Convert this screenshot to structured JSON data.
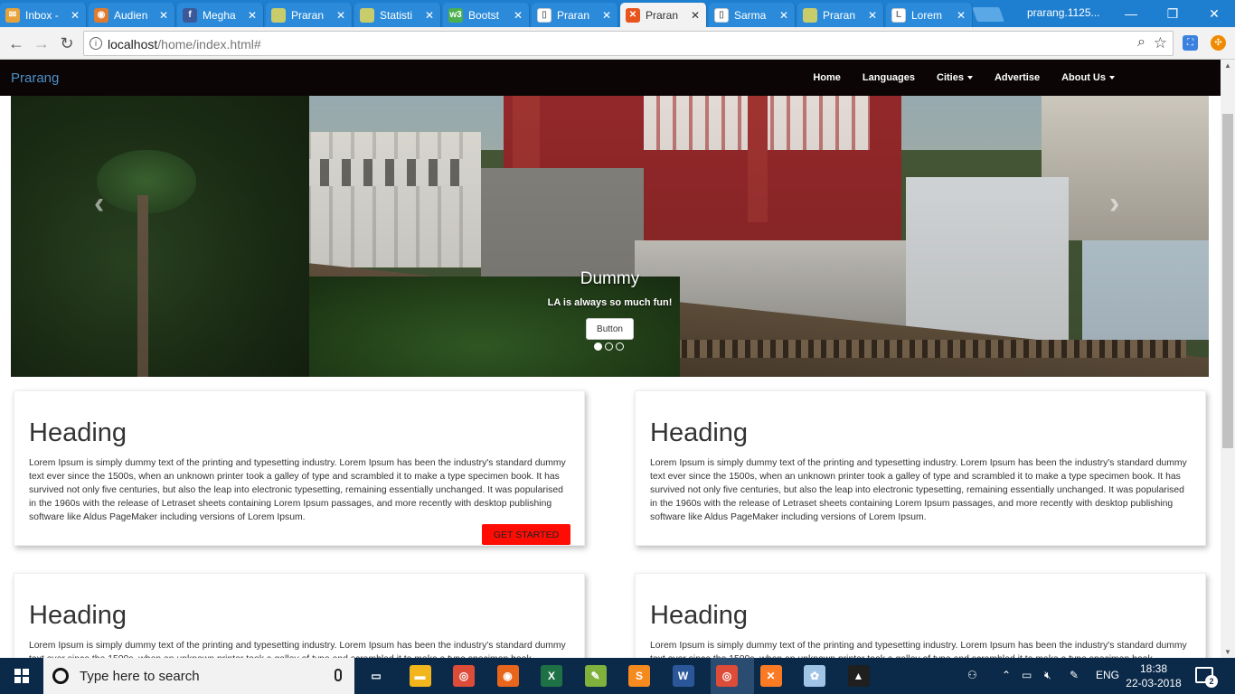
{
  "browser": {
    "tabs": [
      {
        "title": "Inbox - ",
        "color": "#e8a23a",
        "glyph": "✉"
      },
      {
        "title": "Audien",
        "color": "#e07b2f",
        "glyph": "◉"
      },
      {
        "title": "Megha",
        "color": "#3b5998",
        "glyph": "f"
      },
      {
        "title": "Praran",
        "color": "#c9cc6a",
        "glyph": ""
      },
      {
        "title": "Statisti",
        "color": "#c9cc6a",
        "glyph": ""
      },
      {
        "title": "Bootst",
        "color": "#4caf50",
        "glyph": "w3"
      },
      {
        "title": "Praran",
        "color": "#ffffff",
        "glyph": "▯"
      },
      {
        "title": "Praran",
        "color": "#e8541e",
        "glyph": "✕"
      },
      {
        "title": "Sarma",
        "color": "#ffffff",
        "glyph": "▯"
      },
      {
        "title": "Praran",
        "color": "#c9cc6a",
        "glyph": ""
      },
      {
        "title": "Lorem",
        "color": "#ffffff",
        "glyph": "L"
      }
    ],
    "active_tab": 7,
    "profile": "prarang.1125...",
    "window_controls": {
      "minimize": "—",
      "maximize": "❐",
      "close": "✕"
    },
    "url_host": "localhost",
    "url_path": "/home/index.html#",
    "back": "←",
    "forward": "→",
    "reload": "↻",
    "zoom_glyph": "⌕",
    "star_glyph": "☆"
  },
  "site": {
    "brand": "Prarang",
    "menu": [
      {
        "label": "Home",
        "dropdown": false
      },
      {
        "label": "Languages",
        "dropdown": false
      },
      {
        "label": "Cities",
        "dropdown": true
      },
      {
        "label": "Advertise",
        "dropdown": false
      },
      {
        "label": "About Us",
        "dropdown": true
      }
    ],
    "carousel": {
      "title": "Dummy",
      "subtitle": "LA is always so much fun!",
      "button": "Button",
      "prev": "‹",
      "next": "›",
      "slides": 3,
      "active_slide": 0
    },
    "cards": [
      {
        "heading": "Heading",
        "text": "Lorem Ipsum is simply dummy text of the printing and typesetting industry. Lorem Ipsum has been the industry's standard dummy text ever since the 1500s, when an unknown printer took a galley of type and scrambled it to make a type specimen book. It has survived not only five centuries, but also the leap into electronic typesetting, remaining essentially unchanged. It was popularised in the 1960s with the release of Letraset sheets containing Lorem Ipsum passages, and more recently with desktop publishing software like Aldus PageMaker including versions of Lorem Ipsum.",
        "button": "GET STARTED"
      },
      {
        "heading": "Heading",
        "text": "Lorem Ipsum is simply dummy text of the printing and typesetting industry. Lorem Ipsum has been the industry's standard dummy text ever since the 1500s, when an unknown printer took a galley of type and scrambled it to make a type specimen book. It has survived not only five centuries, but also the leap into electronic typesetting, remaining essentially unchanged. It was popularised in the 1960s with the release of Letraset sheets containing Lorem Ipsum passages, and more recently with desktop publishing software like Aldus PageMaker including versions of Lorem Ipsum."
      },
      {
        "heading": "Heading",
        "text": "Lorem Ipsum is simply dummy text of the printing and typesetting industry. Lorem Ipsum has been the industry's standard dummy text ever since the 1500s, when an unknown printer took a galley of type and scrambled it to make a type specimen book."
      },
      {
        "heading": "Heading",
        "text": "Lorem Ipsum is simply dummy text of the printing and typesetting industry. Lorem Ipsum has been the industry's standard dummy text ever since the 1500s, when an unknown printer took a galley of type and scrambled it to make a type specimen book."
      }
    ]
  },
  "taskbar": {
    "search_placeholder": "Type here to search",
    "apps": [
      {
        "name": "task-view",
        "color": "#0b2a4a",
        "glyph": "▭"
      },
      {
        "name": "file-explorer",
        "color": "#f2b51c",
        "glyph": "▬"
      },
      {
        "name": "chrome",
        "color": "#dd4b39",
        "glyph": "◎"
      },
      {
        "name": "firefox",
        "color": "#e8661c",
        "glyph": "◉"
      },
      {
        "name": "excel",
        "color": "#1e7145",
        "glyph": "X"
      },
      {
        "name": "notepad-plus",
        "color": "#7fb13c",
        "glyph": "✎"
      },
      {
        "name": "sublime",
        "color": "#f58a1f",
        "glyph": "S"
      },
      {
        "name": "word",
        "color": "#2b579a",
        "glyph": "W"
      },
      {
        "name": "chrome-active",
        "color": "#dd4b39",
        "glyph": "◎"
      },
      {
        "name": "xampp",
        "color": "#fb7a24",
        "glyph": "✕"
      },
      {
        "name": "paint",
        "color": "#a0c4e6",
        "glyph": "✿"
      },
      {
        "name": "photos",
        "color": "#1f1f1f",
        "glyph": "▲"
      }
    ],
    "language": "ENG",
    "time": "18:38",
    "date": "22-03-2018",
    "notifications": "2"
  }
}
